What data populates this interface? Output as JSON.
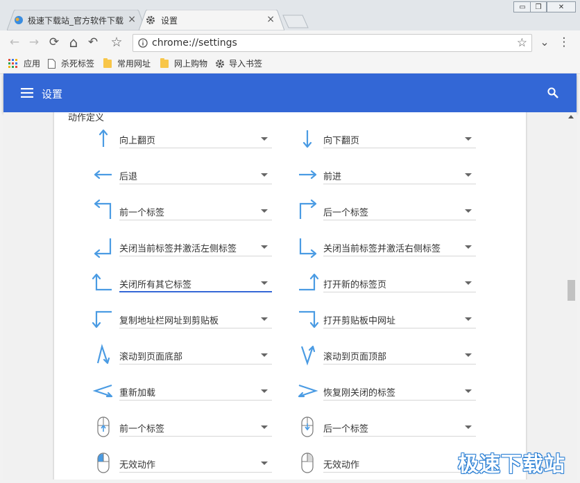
{
  "window": {
    "minimize": "▭",
    "restore": "❐",
    "close": "✕"
  },
  "tabs": [
    {
      "title": "极速下载站_官方软件下载",
      "icon": "site-favicon",
      "close": "×"
    },
    {
      "title": "设置",
      "icon": "gear-icon",
      "close": "×"
    }
  ],
  "toolbar": {
    "back": "←",
    "forward": "→",
    "reload": "⟳",
    "home": "⌂",
    "undo": "↶",
    "star": "☆",
    "url": "chrome://settings",
    "extensions": "⌄",
    "menu": "⋮"
  },
  "bookmarks": [
    {
      "label": "应用",
      "icon": "apps-grid-icon"
    },
    {
      "label": "杀死标签",
      "icon": "page-icon"
    },
    {
      "label": "常用网址",
      "icon": "folder-icon"
    },
    {
      "label": "网上购物",
      "icon": "folder-icon"
    },
    {
      "label": "导入书签",
      "icon": "gear-icon"
    }
  ],
  "header": {
    "title": "设置",
    "menu_icon": "hamburger-icon",
    "search_icon": "search-icon"
  },
  "section": {
    "title": "动作定义"
  },
  "gestures": [
    {
      "left": {
        "icon": "arrow-up",
        "action": "向上翻页"
      },
      "right": {
        "icon": "arrow-down",
        "action": "向下翻页"
      }
    },
    {
      "left": {
        "icon": "arrow-left",
        "action": "后退"
      },
      "right": {
        "icon": "arrow-right",
        "action": "前进"
      }
    },
    {
      "left": {
        "icon": "up-left",
        "action": "前一个标签"
      },
      "right": {
        "icon": "up-right",
        "action": "后一个标签"
      }
    },
    {
      "left": {
        "icon": "down-left",
        "action": "关闭当前标签并激活左侧标签"
      },
      "right": {
        "icon": "down-right",
        "action": "关闭当前标签并激活右侧标签"
      }
    },
    {
      "left": {
        "icon": "left-up",
        "action": "关闭所有其它标签"
      },
      "right": {
        "icon": "right-up",
        "action": "打开新的标签页"
      }
    },
    {
      "left": {
        "icon": "left-down",
        "action": "复制地址栏网址到剪贴板"
      },
      "right": {
        "icon": "right-down",
        "action": "打开剪贴板中网址"
      }
    },
    {
      "left": {
        "icon": "up-down",
        "action": "滚动到页面底部"
      },
      "right": {
        "icon": "down-up",
        "action": "滚动到页面顶部"
      }
    },
    {
      "left": {
        "icon": "left-right",
        "action": "重新加载"
      },
      "right": {
        "icon": "right-left",
        "action": "恢复刚关闭的标签"
      }
    },
    {
      "left": {
        "icon": "mouse-wheel-up",
        "action": "前一个标签"
      },
      "right": {
        "icon": "mouse-wheel-down",
        "action": "后一个标签"
      }
    },
    {
      "left": {
        "icon": "mouse-left-click",
        "action": "无效动作"
      },
      "right": {
        "icon": "mouse-right-click",
        "action": "无效动作"
      }
    }
  ],
  "watermark": "极速下载站",
  "colors": {
    "accent": "#3367d6",
    "gesture": "#4a9be3"
  }
}
